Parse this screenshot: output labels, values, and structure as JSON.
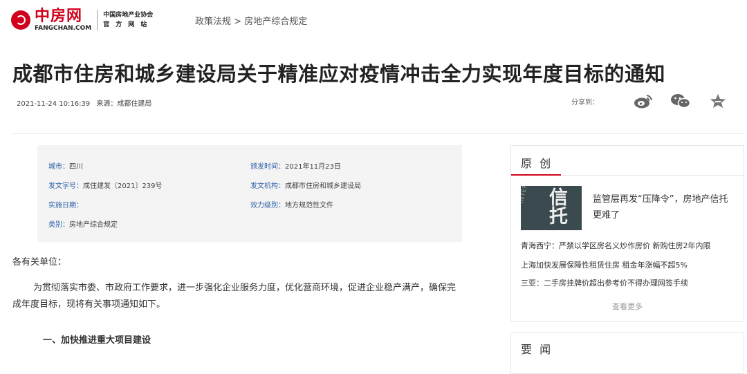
{
  "header": {
    "logo_cn": "中房网",
    "logo_en": "FANGCHAN.COM",
    "assoc_line1": "中国房地产业协会",
    "assoc_line2": "官　方　网　站",
    "breadcrumb": [
      "政策法规",
      ">",
      "房地产综合规定"
    ]
  },
  "article": {
    "title": "成都市住房和城乡建设局关于精准应对疫情冲击全力实现年度目标的通知",
    "datetime": "2021-11-24 10:16:39",
    "source": "来源：成都住建局",
    "share_label": "分享到：",
    "share_icons": [
      "weibo-icon",
      "wechat-icon",
      "favorite-star-icon"
    ]
  },
  "info": {
    "city_key": "城市：",
    "city_val": "四川",
    "issue_time_key": "颁发时间：",
    "issue_time_val": "2021年11月23日",
    "doc_no_key": "发文字号：",
    "doc_no_val": "成住建发〔2021〕239号",
    "issuer_key": "发文机构：",
    "issuer_val": "成都市住房和城乡建设局",
    "effective_key": "实施日期：",
    "effective_val": "",
    "level_key": "效力级别：",
    "level_val": "地方规范性文件",
    "category_key": "类别：",
    "category_val": "房地产综合规定"
  },
  "body": {
    "salutation": "各有关单位：",
    "para1": "为贯彻落实市委、市政府工作要求，进一步强化企业服务力度，优化营商环境，促进企业稳产满产，确保完成年度目标，现将有关事项通知如下。",
    "heading1": "一、加快推进重大项目建设"
  },
  "sidebar": {
    "title": "原 创",
    "thumb_cn": "信托",
    "thumb_en": "INTERNATIO",
    "feature": "监管层再发“压降令”，房地产信托更难了",
    "news": [
      "青海西宁：严禁以学区房名义炒作房价 新购住房2年内限",
      "上海加快发展保障性租赁住房 租金年涨幅不超5%",
      "三亚：二手房挂牌价超出参考价不得办理网签手续"
    ],
    "more": "查看更多",
    "title2": "要 闻"
  },
  "colors": {
    "brand": "#d0021b",
    "link": "#2b5fa8"
  }
}
